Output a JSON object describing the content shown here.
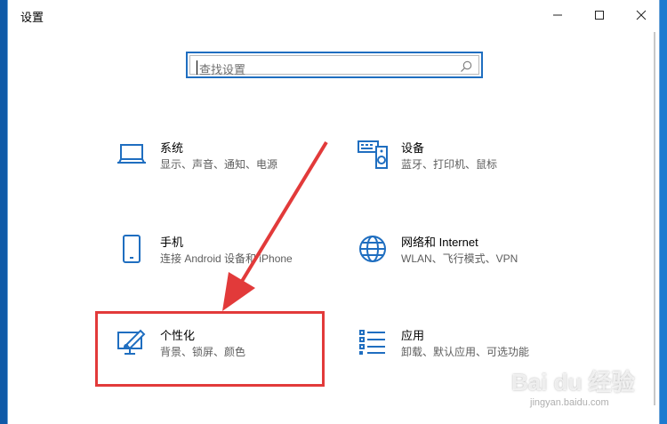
{
  "window": {
    "title": "设置"
  },
  "search": {
    "placeholder": "查找设置"
  },
  "categories": [
    {
      "name": "系统",
      "desc": "显示、声音、通知、电源",
      "icon": "laptop-icon"
    },
    {
      "name": "设备",
      "desc": "蓝牙、打印机、鼠标",
      "icon": "keyboard-device-icon"
    },
    {
      "name": "手机",
      "desc": "连接 Android 设备和 iPhone",
      "icon": "phone-icon"
    },
    {
      "name": "网络和 Internet",
      "desc": "WLAN、飞行模式、VPN",
      "icon": "globe-icon"
    },
    {
      "name": "个性化",
      "desc": "背景、锁屏、颜色",
      "icon": "personalization-brush-icon"
    },
    {
      "name": "应用",
      "desc": "卸载、默认应用、可选功能",
      "icon": "apps-list-icon"
    }
  ],
  "colors": {
    "accent": "#1f6ec0",
    "highlight": "#e23a3a"
  },
  "watermark": {
    "brand": "Bai du 经验",
    "url": "jingyan.baidu.com"
  }
}
